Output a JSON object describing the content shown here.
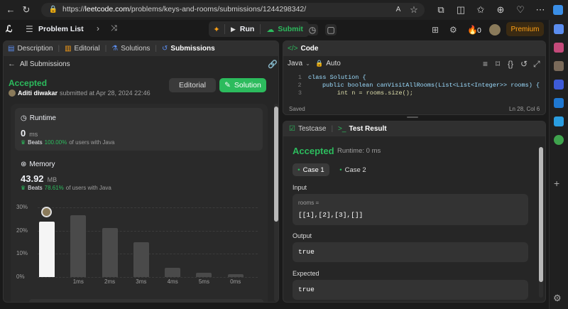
{
  "browser": {
    "url_prefix": "https://",
    "url_host": "leetcode.com",
    "url_path": "/problems/keys-and-rooms/submissions/1244298342/"
  },
  "nav": {
    "problem_list": "Problem List",
    "run": "Run",
    "submit": "Submit",
    "fire_count": "0",
    "premium": "Premium"
  },
  "left": {
    "tabs": [
      "Description",
      "Editorial",
      "Solutions",
      "Submissions"
    ],
    "back_label": "All Submissions",
    "status": "Accepted",
    "author": "Aditi diwakar",
    "submitted": "submitted at Apr 28, 2024 22:46",
    "editorial_btn": "Editorial",
    "solution_btn": "Solution",
    "runtime": {
      "title": "Runtime",
      "value": "0",
      "unit": "ms",
      "beats_label": "Beats",
      "beats_pct": "100.00%",
      "beats_suffix": "of users with Java"
    },
    "memory": {
      "title": "Memory",
      "value": "43.92",
      "unit": "MB",
      "beats_label": "Beats",
      "beats_pct": "78.61%",
      "beats_suffix": "of users with Java"
    }
  },
  "chart_data": {
    "type": "bar",
    "y_ticks": [
      "30%",
      "20%",
      "10%",
      "0%"
    ],
    "ylim": [
      0,
      30
    ],
    "categories": [
      "",
      "1ms",
      "2ms",
      "3ms",
      "4ms",
      "5ms",
      "0ms"
    ],
    "values": [
      24,
      26.5,
      21,
      15,
      4,
      1.8,
      1.2
    ],
    "selected_index": 0,
    "title": "",
    "xlabel": "",
    "ylabel": ""
  },
  "code": {
    "title": "Code",
    "language": "Java",
    "mode": "Auto",
    "lines": [
      {
        "num": "1",
        "text": "class Solution {"
      },
      {
        "num": "2",
        "text": "    public boolean canVisitAllRooms(List<List<Integer>> rooms) {"
      },
      {
        "num": "3",
        "text": "        int n = rooms.size();"
      }
    ],
    "saved": "Saved",
    "position": "Ln 28, Col 6"
  },
  "result": {
    "tab_testcase": "Testcase",
    "tab_result": "Test Result",
    "status": "Accepted",
    "runtime": "Runtime: 0 ms",
    "case1": "Case 1",
    "case2": "Case 2",
    "input_label": "Input",
    "param_name": "rooms =",
    "param_value": "[[1],[2],[3],[]]",
    "output_label": "Output",
    "output_value": "true",
    "expected_label": "Expected",
    "expected_value": "true"
  },
  "colors": {
    "accent_green": "#2cbb5d",
    "premium": "#ffa116",
    "panel_bg": "#262626"
  }
}
